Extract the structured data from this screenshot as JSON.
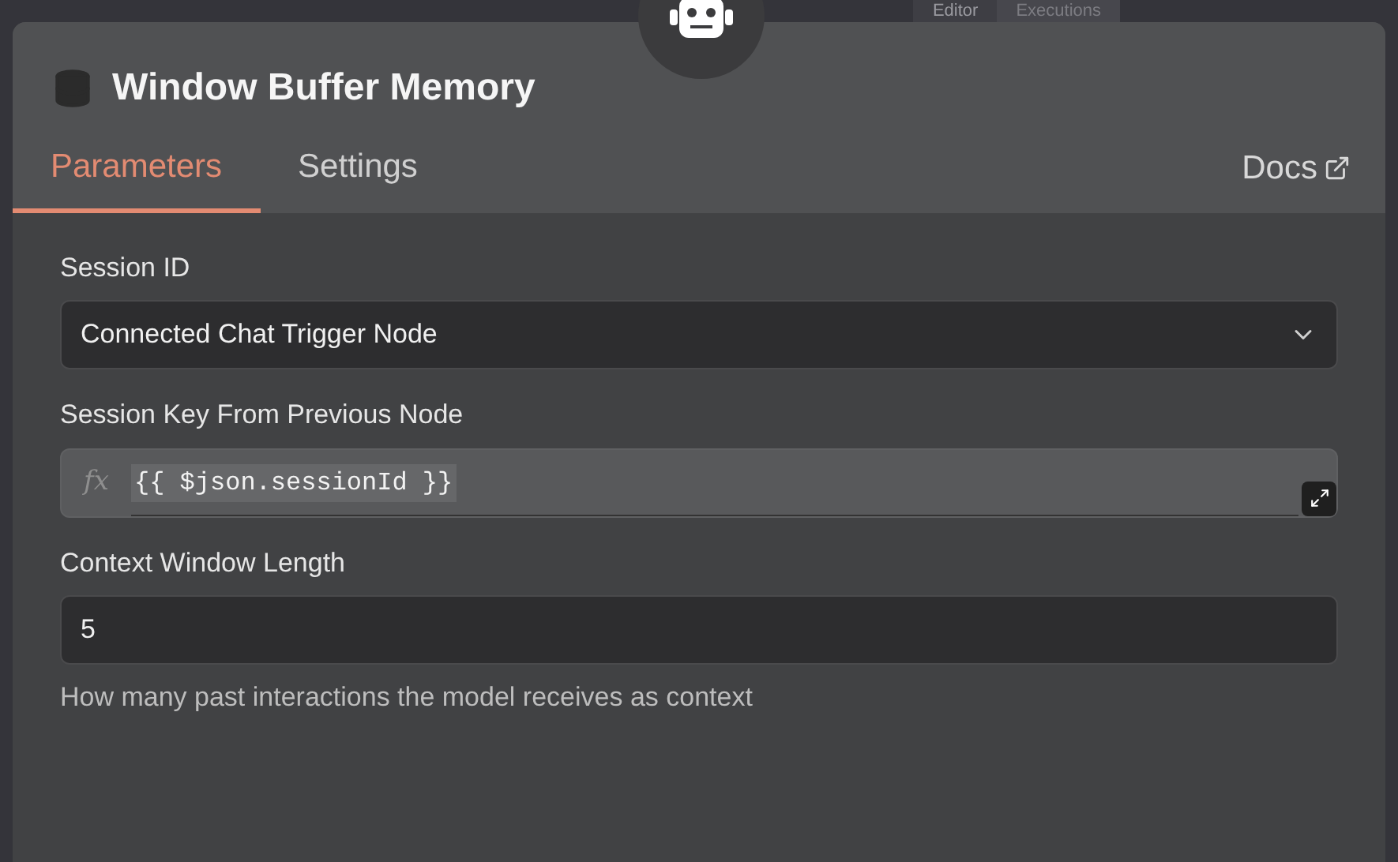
{
  "background_tabs": [
    {
      "label": "Editor",
      "selected": true
    },
    {
      "label": "Executions",
      "selected": false
    }
  ],
  "panel": {
    "title": "Window Buffer Memory",
    "tabs": [
      {
        "label": "Parameters",
        "selected": true
      },
      {
        "label": "Settings",
        "selected": false
      }
    ],
    "docs_link": "Docs",
    "fields": [
      {
        "kind": "select",
        "label": "Session ID",
        "value": "Connected Chat Trigger Node"
      },
      {
        "kind": "expression",
        "label": "Session Key From Previous Node",
        "prefix": "fx",
        "value": "{{ $json.sessionId }}"
      },
      {
        "kind": "number",
        "label": "Context Window Length",
        "value": "5",
        "hint": "How many past interactions the model receives as context"
      }
    ]
  }
}
